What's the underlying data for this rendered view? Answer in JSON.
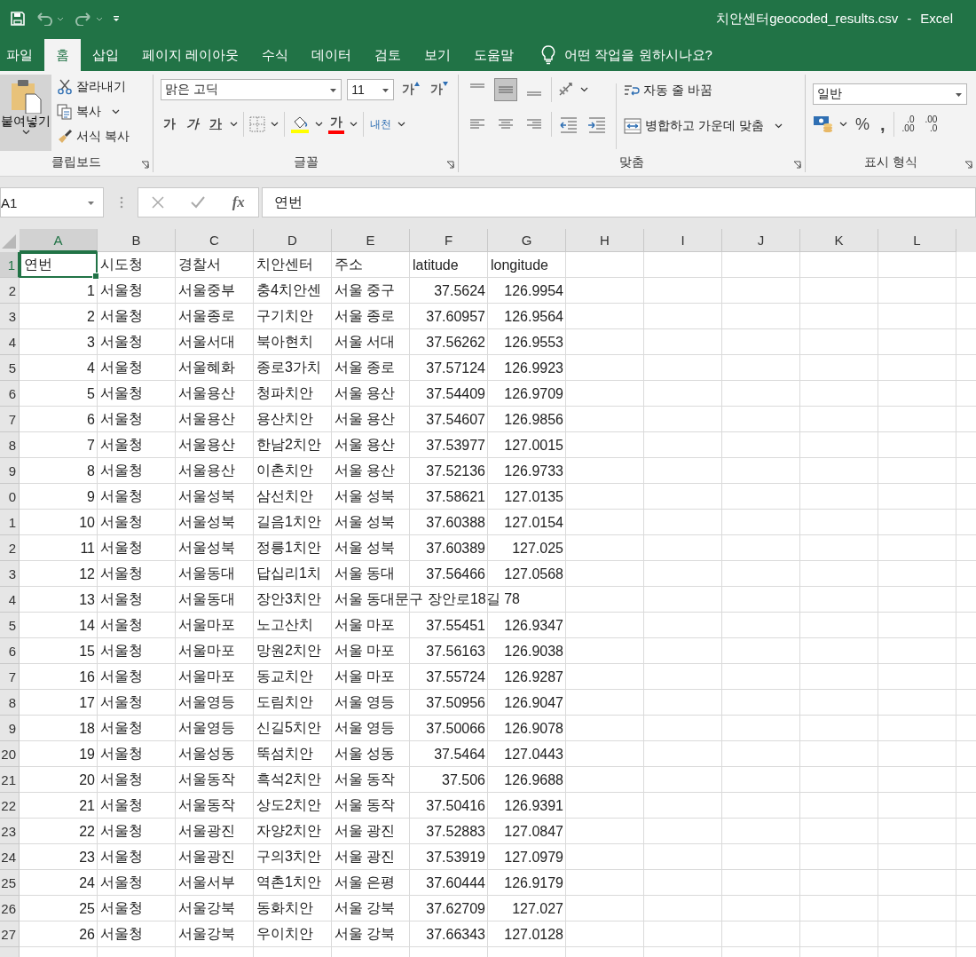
{
  "title_bar": {
    "title": "치안센터geocoded_results.csv",
    "separator": "-",
    "app": "Excel"
  },
  "tabs": [
    {
      "label": "파일",
      "selected": false
    },
    {
      "label": "홈",
      "selected": true
    },
    {
      "label": "삽입",
      "selected": false
    },
    {
      "label": "페이지 레이아웃",
      "selected": false
    },
    {
      "label": "수식",
      "selected": false
    },
    {
      "label": "데이터",
      "selected": false
    },
    {
      "label": "검토",
      "selected": false
    },
    {
      "label": "보기",
      "selected": false
    },
    {
      "label": "도움말",
      "selected": false
    }
  ],
  "tell_me": "어떤 작업을 원하시나요?",
  "clipboard": {
    "paste": "붙여넣기",
    "cut": "잘라내기",
    "copy": "복사",
    "format_painter": "서식 복사",
    "group": "클립보드"
  },
  "font": {
    "name": "맑은 고딕",
    "size": "11",
    "grow": "가",
    "shrink": "가",
    "bold": "가",
    "italic": "가",
    "underline": "가",
    "font_color": "가",
    "phonetic": "내천",
    "group": "글꼴"
  },
  "alignment": {
    "vertical": [
      {
        "kind": "top",
        "selected": false
      },
      {
        "kind": "middle",
        "selected": true
      },
      {
        "kind": "bottom",
        "selected": false
      }
    ],
    "wrap": "자동 줄 바꿈",
    "merge": "병합하고 가운데 맞춤",
    "group": "맞춤"
  },
  "number": {
    "format": "일반",
    "percent": "%",
    "comma": ",",
    "decimals": [
      {
        "top": ".0",
        "bottom": ".00"
      },
      {
        "top": ".00",
        "bottom": ".0"
      }
    ],
    "group": "표시 형식"
  },
  "formula_bar": {
    "name_box": "A1",
    "fx": "fx",
    "content": "연번"
  },
  "columns": [
    {
      "letter": "A",
      "selected": true,
      "numeric": true
    },
    {
      "letter": "B",
      "selected": false,
      "numeric": false
    },
    {
      "letter": "C",
      "selected": false,
      "numeric": false
    },
    {
      "letter": "D",
      "selected": false,
      "numeric": false
    },
    {
      "letter": "E",
      "selected": false,
      "numeric": false
    },
    {
      "letter": "F",
      "selected": false,
      "numeric": true
    },
    {
      "letter": "G",
      "selected": false,
      "numeric": true
    },
    {
      "letter": "H",
      "selected": false
    },
    {
      "letter": "I",
      "selected": false
    },
    {
      "letter": "J",
      "selected": false
    },
    {
      "letter": "K",
      "selected": false
    },
    {
      "letter": "L",
      "selected": false
    }
  ],
  "rows": [
    {
      "number": "1",
      "kind": "labels",
      "selected": true,
      "cells": [
        "연번",
        "시도청",
        "경찰서",
        "치안센터",
        "주소",
        "latitude",
        "longitude"
      ]
    },
    {
      "number": "2",
      "kind": "data",
      "selected": false,
      "cells": [
        "1",
        "서울청",
        "서울중부",
        "충4치안센",
        "서울 중구",
        "37.5624",
        "126.9954"
      ]
    },
    {
      "number": "3",
      "kind": "data",
      "selected": false,
      "cells": [
        "2",
        "서울청",
        "서울종로",
        "구기치안",
        "서울 종로",
        "37.60957",
        "126.9564"
      ]
    },
    {
      "number": "4",
      "kind": "data",
      "selected": false,
      "cells": [
        "3",
        "서울청",
        "서울서대",
        "북아현치",
        "서울 서대",
        "37.56262",
        "126.9553"
      ]
    },
    {
      "number": "5",
      "kind": "data",
      "selected": false,
      "cells": [
        "4",
        "서울청",
        "서울혜화",
        "종로3가치",
        "서울 종로",
        "37.57124",
        "126.9923"
      ]
    },
    {
      "number": "6",
      "kind": "data",
      "selected": false,
      "cells": [
        "5",
        "서울청",
        "서울용산",
        "청파치안",
        "서울 용산",
        "37.54409",
        "126.9709"
      ]
    },
    {
      "number": "7",
      "kind": "data",
      "selected": false,
      "cells": [
        "6",
        "서울청",
        "서울용산",
        "용산치안",
        "서울 용산",
        "37.54607",
        "126.9856"
      ]
    },
    {
      "number": "8",
      "kind": "data",
      "selected": false,
      "cells": [
        "7",
        "서울청",
        "서울용산",
        "한남2치안",
        "서울 용산",
        "37.53977",
        "127.0015"
      ]
    },
    {
      "number": "9",
      "kind": "data",
      "selected": false,
      "cells": [
        "8",
        "서울청",
        "서울용산",
        "이촌치안",
        "서울 용산",
        "37.52136",
        "126.9733"
      ]
    },
    {
      "number": "0",
      "kind": "data",
      "selected": false,
      "cells": [
        "9",
        "서울청",
        "서울성북",
        "삼선치안",
        "서울 성북",
        "37.58621",
        "127.0135"
      ]
    },
    {
      "number": "1",
      "kind": "data",
      "selected": false,
      "cells": [
        "10",
        "서울청",
        "서울성북",
        "길음1치안",
        "서울 성북",
        "37.60388",
        "127.0154"
      ]
    },
    {
      "number": "2",
      "kind": "data",
      "selected": false,
      "cells": [
        "11",
        "서울청",
        "서울성북",
        "정릉1치안",
        "서울 성북",
        "37.60389",
        "127.025"
      ]
    },
    {
      "number": "3",
      "kind": "data",
      "selected": false,
      "cells": [
        "12",
        "서울청",
        "서울동대",
        "답십리1치",
        "서울 동대",
        "37.56466",
        "127.0568"
      ]
    },
    {
      "number": "4",
      "kind": "data",
      "selected": false,
      "cells": [
        "13",
        "서울청",
        "서울동대",
        "장안3치안",
        "서울 동대문구 장안로18길 78"
      ]
    },
    {
      "number": "5",
      "kind": "data",
      "selected": false,
      "cells": [
        "14",
        "서울청",
        "서울마포",
        "노고산치",
        "서울 마포",
        "37.55451",
        "126.9347"
      ]
    },
    {
      "number": "6",
      "kind": "data",
      "selected": false,
      "cells": [
        "15",
        "서울청",
        "서울마포",
        "망원2치안",
        "서울 마포",
        "37.56163",
        "126.9038"
      ]
    },
    {
      "number": "7",
      "kind": "data",
      "selected": false,
      "cells": [
        "16",
        "서울청",
        "서울마포",
        "동교치안",
        "서울 마포",
        "37.55724",
        "126.9287"
      ]
    },
    {
      "number": "8",
      "kind": "data",
      "selected": false,
      "cells": [
        "17",
        "서울청",
        "서울영등",
        "도림치안",
        "서울 영등",
        "37.50956",
        "126.9047"
      ]
    },
    {
      "number": "9",
      "kind": "data",
      "selected": false,
      "cells": [
        "18",
        "서울청",
        "서울영등",
        "신길5치안",
        "서울 영등",
        "37.50066",
        "126.9078"
      ]
    },
    {
      "number": "20",
      "kind": "data",
      "selected": false,
      "cells": [
        "19",
        "서울청",
        "서울성동",
        "뚝섬치안",
        "서울 성동",
        "37.5464",
        "127.0443"
      ]
    },
    {
      "number": "21",
      "kind": "data",
      "selected": false,
      "cells": [
        "20",
        "서울청",
        "서울동작",
        "흑석2치안",
        "서울 동작",
        "37.506",
        "126.9688"
      ]
    },
    {
      "number": "22",
      "kind": "data",
      "selected": false,
      "cells": [
        "21",
        "서울청",
        "서울동작",
        "상도2치안",
        "서울 동작",
        "37.50416",
        "126.9391"
      ]
    },
    {
      "number": "23",
      "kind": "data",
      "selected": false,
      "cells": [
        "22",
        "서울청",
        "서울광진",
        "자양2치안",
        "서울 광진",
        "37.52883",
        "127.0847"
      ]
    },
    {
      "number": "24",
      "kind": "data",
      "selected": false,
      "cells": [
        "23",
        "서울청",
        "서울광진",
        "구의3치안",
        "서울 광진",
        "37.53919",
        "127.0979"
      ]
    },
    {
      "number": "25",
      "kind": "data",
      "selected": false,
      "cells": [
        "24",
        "서울청",
        "서울서부",
        "역촌1치안",
        "서울 은평",
        "37.60444",
        "126.9179"
      ]
    },
    {
      "number": "26",
      "kind": "data",
      "selected": false,
      "cells": [
        "25",
        "서울청",
        "서울강북",
        "동화치안",
        "서울 강북",
        "37.62709",
        "127.027"
      ]
    },
    {
      "number": "27",
      "kind": "data",
      "selected": false,
      "cells": [
        "26",
        "서울청",
        "서울강북",
        "우이치안",
        "서울 강북",
        "37.66343",
        "127.0128"
      ]
    }
  ]
}
